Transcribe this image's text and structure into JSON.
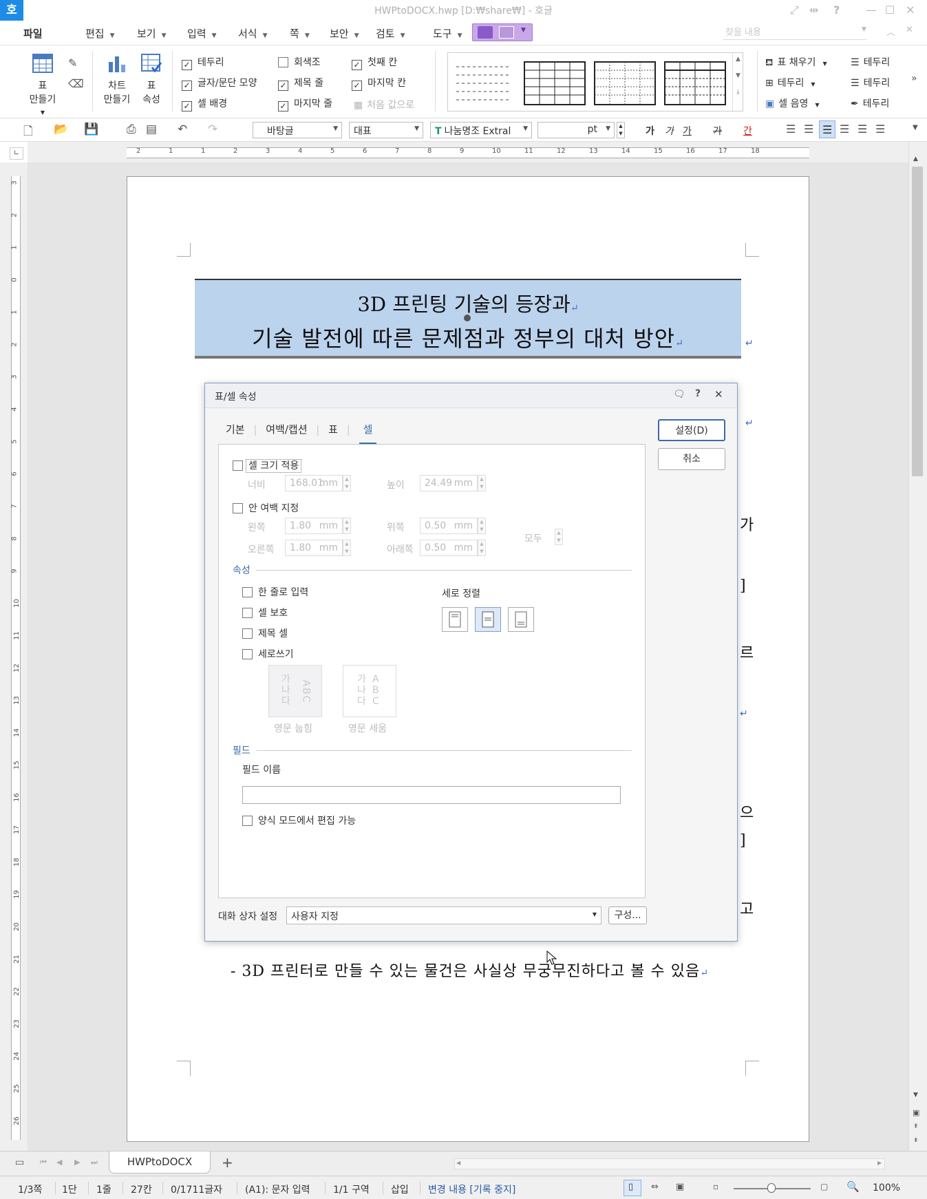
{
  "app": {
    "logo": "호",
    "window_title": "HWPtoDOCX.hwp [D:₩share₩] - 호글",
    "find_placeholder": "찾을 내용"
  },
  "menu": {
    "file": "파일",
    "items": [
      "편집",
      "보기",
      "입력",
      "서식",
      "쪽",
      "보안",
      "검토",
      "도구"
    ]
  },
  "ribbon": {
    "table_make": [
      "표",
      "만들기"
    ],
    "chart_make": [
      "차트",
      "만들기"
    ],
    "table_props": [
      "표",
      "속성"
    ],
    "checks": [
      {
        "label": "테두리",
        "checked": true
      },
      {
        "label": "글자/문단 모양",
        "checked": true
      },
      {
        "label": "셀 배경",
        "checked": true
      },
      {
        "label": "회색조",
        "checked": false
      },
      {
        "label": "제목 줄",
        "checked": true
      },
      {
        "label": "마지막 줄",
        "checked": true
      },
      {
        "label": "첫째 칸",
        "checked": true
      },
      {
        "label": "마지막 칸",
        "checked": true
      }
    ],
    "reset_label": "처음 값으로",
    "fill": "표 채우기",
    "border": "테두리",
    "cell_shade": "셀 음영",
    "border_right": [
      "테두리",
      "테두리",
      "테두리"
    ]
  },
  "toolbar2": {
    "style": "바탕글",
    "lang": "대표",
    "font": "나눔명조 Extral",
    "size_unit": "pt",
    "fmt": [
      "가",
      "가",
      "가",
      "가",
      "간"
    ]
  },
  "ruler": {
    "h": [
      "2",
      "1",
      "1",
      "2",
      "3",
      "4",
      "5",
      "6",
      "7",
      "8",
      "9",
      "10",
      "11",
      "12",
      "13",
      "14",
      "15",
      "16",
      "17",
      "18"
    ],
    "v": [
      "3",
      "2",
      "1",
      "0",
      "1",
      "2",
      "3",
      "4",
      "5",
      "6",
      "7",
      "8",
      "9",
      "10",
      "11",
      "12",
      "13",
      "14",
      "15",
      "16",
      "17",
      "18",
      "19",
      "20",
      "21",
      "22",
      "23",
      "24",
      "25",
      "26"
    ]
  },
  "document": {
    "title_line1": "3D 프린팅 기술의 등장과",
    "title_line2": "기술 발전에 따른 문제점과 정부의 대처 방안",
    "bottom_line": "- 3D 프린터로 만들 수 있는 물건은 사실상 무궁무진하다고 볼 수 있음",
    "side_fragments": [
      "가",
      "]",
      "르",
      "으",
      "]",
      "고"
    ]
  },
  "dialog": {
    "title": "표/셀 속성",
    "tabs": [
      "기본",
      "여백/캡션",
      "표",
      "셀"
    ],
    "active_tab": "셀",
    "ok": "설정(D)",
    "cancel": "취소",
    "cell_size": "셀 크기 적용",
    "width_label": "너비",
    "width_value": "168.01",
    "height_label": "높이",
    "height_value": "24.49",
    "unit": "mm",
    "inner_margin": "안 여백 지정",
    "left_label": "왼쪽",
    "left_value": "1.80",
    "top_label": "위쪽",
    "top_value": "0.50",
    "right_label": "오른쪽",
    "right_value": "1.80",
    "bottom_label": "아래쪽",
    "bottom_value": "0.50",
    "all_label": "모두",
    "props_section": "속성",
    "single_line": "한 줄로 입력",
    "cell_protect": "셀 보호",
    "title_cell": "제목 셀",
    "vertical_write": "세로쓰기",
    "v_align": "세로 정렬",
    "eng_lay": "영문 눕힘",
    "eng_stand": "영문 세움",
    "glyph_k": [
      "가",
      "나",
      "다"
    ],
    "glyph_e": [
      "A",
      "B",
      "C"
    ],
    "field_section": "필드",
    "field_name": "필드 이름",
    "form_edit": "양식 모드에서 편집 가능",
    "dlg_setting": "대화 상자 설정",
    "dlg_setting_value": "사용자 지정",
    "compose": "구성..."
  },
  "tab": {
    "name": "HWPtoDOCX",
    "plus": "+"
  },
  "status": {
    "page": "1/3쪽",
    "col": "1단",
    "line": "1줄",
    "char": "27칸",
    "count": "0/1711글자",
    "mode": "(A1): 문자 입력",
    "section": "1/1 구역",
    "insert": "삽입",
    "track": "변경 내용 [기록 중지]",
    "zoom": "100%"
  },
  "colors": {
    "accent": "#1e8ce6",
    "title_cell_bg": "#bcd3ee",
    "dialog_link": "#3a6aa8",
    "active_valign": "#dde8f8"
  }
}
